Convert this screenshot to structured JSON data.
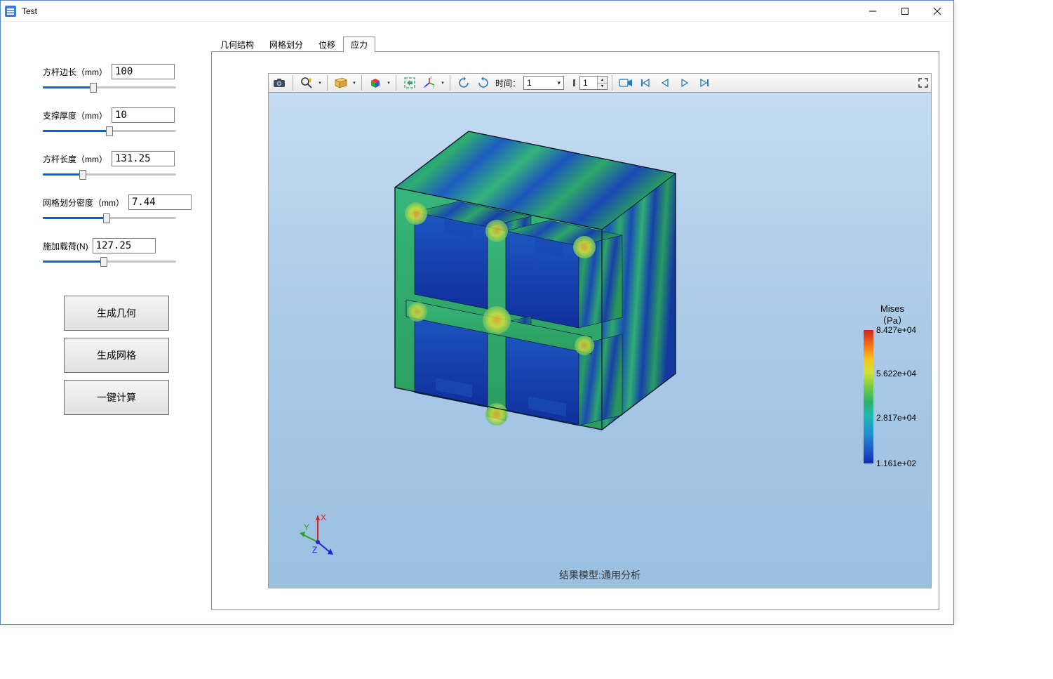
{
  "window": {
    "title": "Test"
  },
  "sidebar": {
    "params": [
      {
        "label": "方杆边长（mm）",
        "value": "100",
        "percent": 38
      },
      {
        "label": "支撑厚度（mm）",
        "value": "10",
        "percent": 50
      },
      {
        "label": "方杆长度（mm）",
        "value": "131.25",
        "percent": 30
      },
      {
        "label": "网格划分密度（mm）",
        "value": "7.44",
        "percent": 48
      },
      {
        "label": "施加载荷(N)",
        "value": "127.25",
        "percent": 46
      }
    ],
    "buttons": {
      "gen_geom": "生成几何",
      "gen_mesh": "生成网格",
      "one_click": "一键计算"
    }
  },
  "tabs": {
    "items": [
      "几何结构",
      "网格划分",
      "位移",
      "应力"
    ],
    "active_index": 3
  },
  "toolbar": {
    "time_label": "时间：",
    "time_combo": "1",
    "frame_spin": "1"
  },
  "viewer": {
    "caption": "结果模型:通用分析",
    "triad": {
      "x": "X",
      "y": "Y",
      "z": "Z"
    }
  },
  "legend": {
    "title_line1": "Mises",
    "title_line2": "（Pa）",
    "ticks": [
      {
        "label": "8.427e+04",
        "pos": 0
      },
      {
        "label": "5.622e+04",
        "pos": 33
      },
      {
        "label": "2.817e+04",
        "pos": 66
      },
      {
        "label": "1.161e+02",
        "pos": 100
      }
    ]
  }
}
